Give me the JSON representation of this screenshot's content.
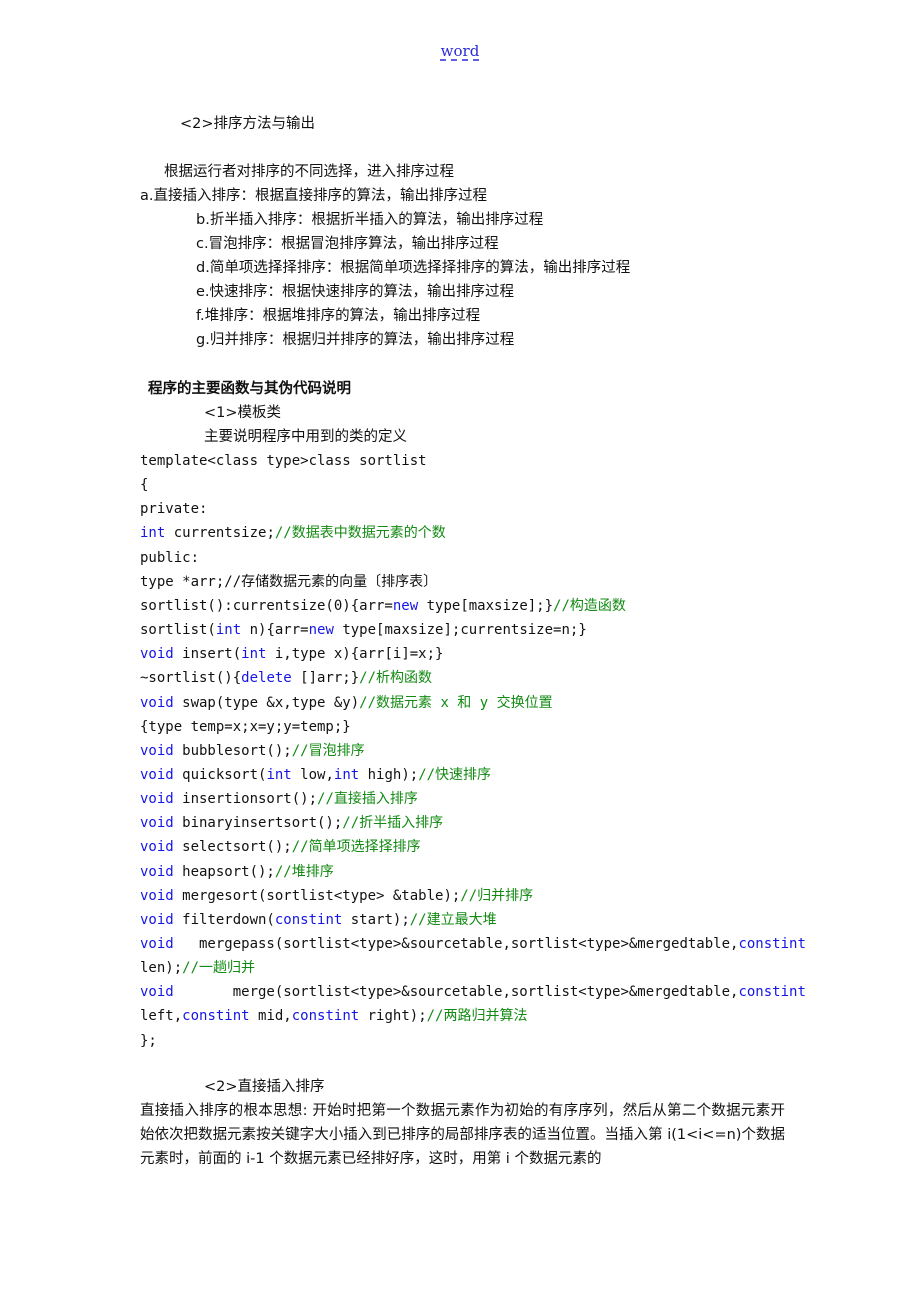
{
  "header": {
    "link_text": "word"
  },
  "section_sort_output": {
    "heading": "<2>排序方法与输出",
    "intro": "根据运行者对排序的不同选择，进入排序过程",
    "items": [
      "a.直接插入排序：根据直接排序的算法，输出排序过程",
      "b.折半插入排序：根据折半插入的算法，输出排序过程",
      "c.冒泡排序：根据冒泡排序算法，输出排序过程",
      "d.简单项选择择排序：根据简单项选择择排序的算法，输出排序过程",
      "e.快速排序：根据快速排序的算法，输出排序过程",
      "f.堆排序：根据堆排序的算法，输出排序过程",
      "g.归并排序：根据归并排序的算法，输出排序过程"
    ]
  },
  "section_functions": {
    "title": "程序的主要函数与其伪代码说明",
    "subheading": "<1>模板类",
    "description": "主要说明程序中用到的类的定义",
    "code_lines": [
      [
        {
          "t": "template<class type>class sortlist",
          "c": "plain"
        }
      ],
      [
        {
          "t": "{",
          "c": "plain"
        }
      ],
      [
        {
          "t": "private:",
          "c": "plain"
        }
      ],
      [
        {
          "t": "int",
          "c": "kw"
        },
        {
          "t": " currentsize;",
          "c": "plain"
        },
        {
          "t": "//数据表中数据元素的个数",
          "c": "cm"
        }
      ],
      [
        {
          "t": "public:",
          "c": "plain"
        }
      ],
      [
        {
          "t": "type *arr;//存储数据元素的向量〔排序表〕",
          "c": "plain"
        }
      ],
      [
        {
          "t": "sortlist():currentsize(0){arr=",
          "c": "plain"
        },
        {
          "t": "new",
          "c": "kw"
        },
        {
          "t": " type[maxsize];}",
          "c": "plain"
        },
        {
          "t": "//构造函数",
          "c": "cm"
        }
      ],
      [
        {
          "t": "sortlist(",
          "c": "plain"
        },
        {
          "t": "int",
          "c": "kw"
        },
        {
          "t": " n){arr=",
          "c": "plain"
        },
        {
          "t": "new",
          "c": "kw"
        },
        {
          "t": " type[maxsize];currentsize=n;}",
          "c": "plain"
        }
      ],
      [
        {
          "t": "void",
          "c": "kw"
        },
        {
          "t": " insert(",
          "c": "plain"
        },
        {
          "t": "int",
          "c": "kw"
        },
        {
          "t": " i,type x){arr[i]=x;}",
          "c": "plain"
        }
      ],
      [
        {
          "t": "~sortlist(){",
          "c": "plain"
        },
        {
          "t": "delete",
          "c": "kw"
        },
        {
          "t": " []arr;}",
          "c": "plain"
        },
        {
          "t": "//析构函数",
          "c": "cm"
        }
      ],
      [
        {
          "t": "void",
          "c": "kw"
        },
        {
          "t": " swap(type &x,type &y)",
          "c": "plain"
        },
        {
          "t": "//数据元素 x 和 y 交换位置",
          "c": "cm"
        }
      ],
      [
        {
          "t": "{type temp=x;x=y;y=temp;}",
          "c": "plain"
        }
      ],
      [
        {
          "t": "void",
          "c": "kw"
        },
        {
          "t": " bubblesort();",
          "c": "plain"
        },
        {
          "t": "//冒泡排序",
          "c": "cm"
        }
      ],
      [
        {
          "t": "void",
          "c": "kw"
        },
        {
          "t": " quicksort(",
          "c": "plain"
        },
        {
          "t": "int",
          "c": "kw"
        },
        {
          "t": " low,",
          "c": "plain"
        },
        {
          "t": "int",
          "c": "kw"
        },
        {
          "t": " high);",
          "c": "plain"
        },
        {
          "t": "//快速排序",
          "c": "cm"
        }
      ],
      [
        {
          "t": "void",
          "c": "kw"
        },
        {
          "t": " insertionsort();",
          "c": "plain"
        },
        {
          "t": "//直接插入排序",
          "c": "cm"
        }
      ],
      [
        {
          "t": "void",
          "c": "kw"
        },
        {
          "t": " binaryinsertsort();",
          "c": "plain"
        },
        {
          "t": "//折半插入排序",
          "c": "cm"
        }
      ],
      [
        {
          "t": "void",
          "c": "kw"
        },
        {
          "t": " selectsort();",
          "c": "plain"
        },
        {
          "t": "//简单项选择择排序",
          "c": "cm"
        }
      ],
      [
        {
          "t": "void",
          "c": "kw"
        },
        {
          "t": " heapsort();",
          "c": "plain"
        },
        {
          "t": "//堆排序",
          "c": "cm"
        }
      ],
      [
        {
          "t": "void",
          "c": "kw"
        },
        {
          "t": " mergesort(sortlist<type> &table);",
          "c": "plain"
        },
        {
          "t": "//归并排序",
          "c": "cm"
        }
      ],
      [
        {
          "t": "void",
          "c": "kw"
        },
        {
          "t": " filterdown(",
          "c": "plain"
        },
        {
          "t": "constint",
          "c": "kw"
        },
        {
          "t": " start);",
          "c": "plain"
        },
        {
          "t": "//建立最大堆",
          "c": "cm"
        }
      ],
      [
        {
          "t": "void",
          "c": "kw"
        },
        {
          "t": "   mergepass(sortlist<type>&sourcetable,sortlist<type>&mergedtable,",
          "c": "plain"
        },
        {
          "t": "constint",
          "c": "kw"
        }
      ],
      [
        {
          "t": "len);",
          "c": "plain"
        },
        {
          "t": "//一趟归并",
          "c": "cm"
        }
      ],
      [
        {
          "t": "void",
          "c": "kw"
        },
        {
          "t": "       merge(sortlist<type>&sourcetable,sortlist<type>&mergedtable,",
          "c": "plain"
        },
        {
          "t": "constint",
          "c": "kw"
        }
      ],
      [
        {
          "t": "left,",
          "c": "plain"
        },
        {
          "t": "constint",
          "c": "kw"
        },
        {
          "t": " mid,",
          "c": "plain"
        },
        {
          "t": "constint",
          "c": "kw"
        },
        {
          "t": " right);",
          "c": "plain"
        },
        {
          "t": "//两路归并算法",
          "c": "cm"
        }
      ],
      [
        {
          "t": "};",
          "c": "plain"
        }
      ]
    ]
  },
  "section_insertion": {
    "heading": "<2>直接插入排序",
    "paragraph": "直接插入排序的根本思想: 开始时把第一个数据元素作为初始的有序序列，然后从第二个数据元素开始依次把数据元素按关键字大小插入到已排序的局部排序表的适当位置。当插入第 i(1<i<=n)个数据元素时，前面的 i-1 个数据元素已经排好序，这时，用第 i 个数据元素的"
  },
  "colors": {
    "keyword": "#1515e6",
    "comment": "#138a13",
    "link": "#2a2ad8",
    "text": "#111111"
  }
}
